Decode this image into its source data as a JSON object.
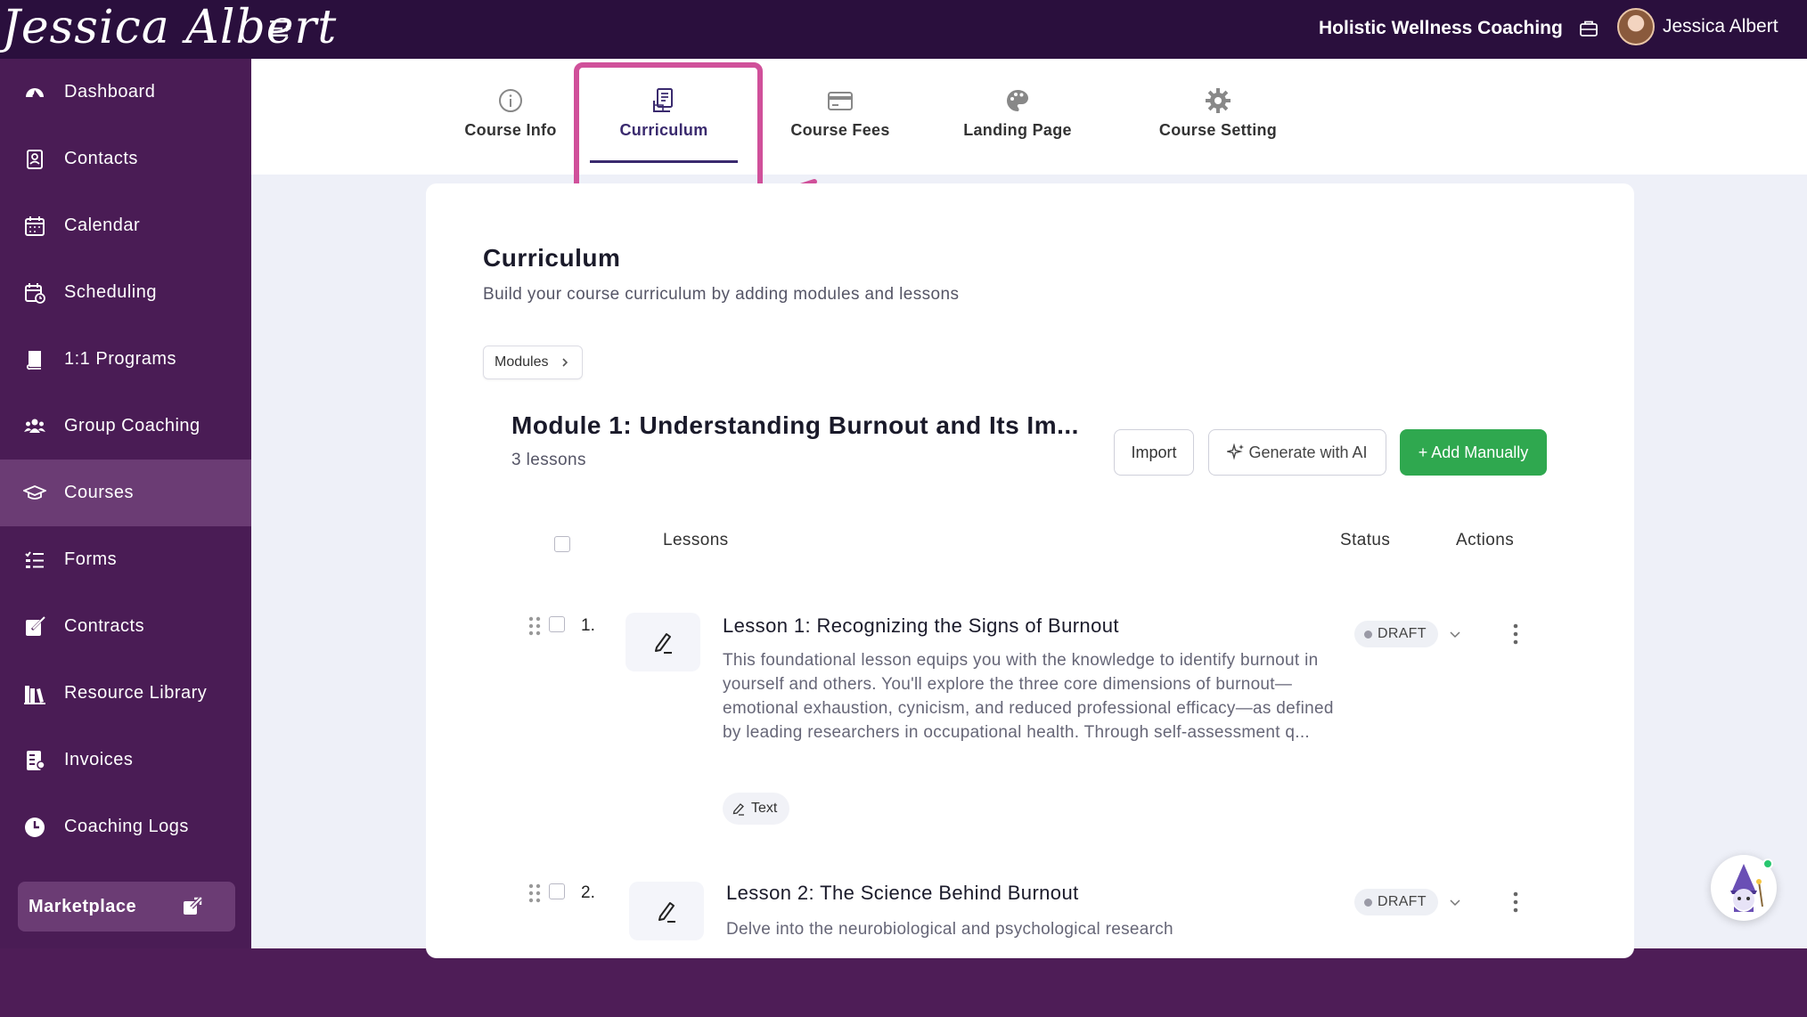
{
  "brand": {
    "logo_text": "Jessica Albert"
  },
  "header": {
    "org_name": "Holistic Wellness Coaching",
    "user_name": "Jessica Albert"
  },
  "sidebar": {
    "items": [
      {
        "label": "Dashboard",
        "icon": "dashboard-icon"
      },
      {
        "label": "Contacts",
        "icon": "contacts-icon"
      },
      {
        "label": "Calendar",
        "icon": "calendar-icon"
      },
      {
        "label": "Scheduling",
        "icon": "scheduling-icon"
      },
      {
        "label": "1:1 Programs",
        "icon": "book-icon"
      },
      {
        "label": "Group Coaching",
        "icon": "group-icon"
      },
      {
        "label": "Courses",
        "icon": "graduation-cap-icon",
        "active": true
      },
      {
        "label": "Forms",
        "icon": "forms-icon"
      },
      {
        "label": "Contracts",
        "icon": "contract-icon"
      },
      {
        "label": "Resource Library",
        "icon": "library-icon"
      },
      {
        "label": "Invoices",
        "icon": "invoice-icon"
      },
      {
        "label": "Coaching Logs",
        "icon": "clock-icon"
      }
    ],
    "marketplace": "Marketplace"
  },
  "tabs": [
    {
      "label": "Course Info",
      "icon": "info-icon"
    },
    {
      "label": "Curriculum",
      "icon": "curriculum-icon",
      "active": true
    },
    {
      "label": "Course Fees",
      "icon": "credit-card-icon"
    },
    {
      "label": "Landing Page",
      "icon": "palette-icon"
    },
    {
      "label": "Course Setting",
      "icon": "gear-icon"
    }
  ],
  "curriculum": {
    "title": "Curriculum",
    "subtitle": "Build your course curriculum by adding modules and lessons",
    "breadcrumb": "Modules"
  },
  "module": {
    "title": "Module 1: Understanding Burnout and Its Im...",
    "count": "3 lessons",
    "buttons": {
      "import": "Import",
      "generate": "Generate with AI",
      "add": "+ Add Manually"
    }
  },
  "table": {
    "col_lessons": "Lessons",
    "col_status": "Status",
    "col_actions": "Actions"
  },
  "lessons": [
    {
      "num": "1.",
      "title": "Lesson 1: Recognizing the Signs of Burnout",
      "description": "This foundational lesson equips you with the knowledge to identify burnout in yourself and others. You'll explore the three core dimensions of burnout—emotional exhaustion, cynicism, and reduced professional efficacy—as defined by leading researchers in occupational health. Through self-assessment q...",
      "type": "Text",
      "status": "DRAFT"
    },
    {
      "num": "2.",
      "title": "Lesson 2: The Science Behind Burnout",
      "description": "Delve into the neurobiological and psychological research",
      "status": "DRAFT"
    }
  ],
  "colors": {
    "topbar": "#2a0f3d",
    "sidebar": "#4a1c55",
    "accent_green": "#2fa84f",
    "highlight": "#d0509a",
    "tab_active": "#3a2a6e"
  }
}
